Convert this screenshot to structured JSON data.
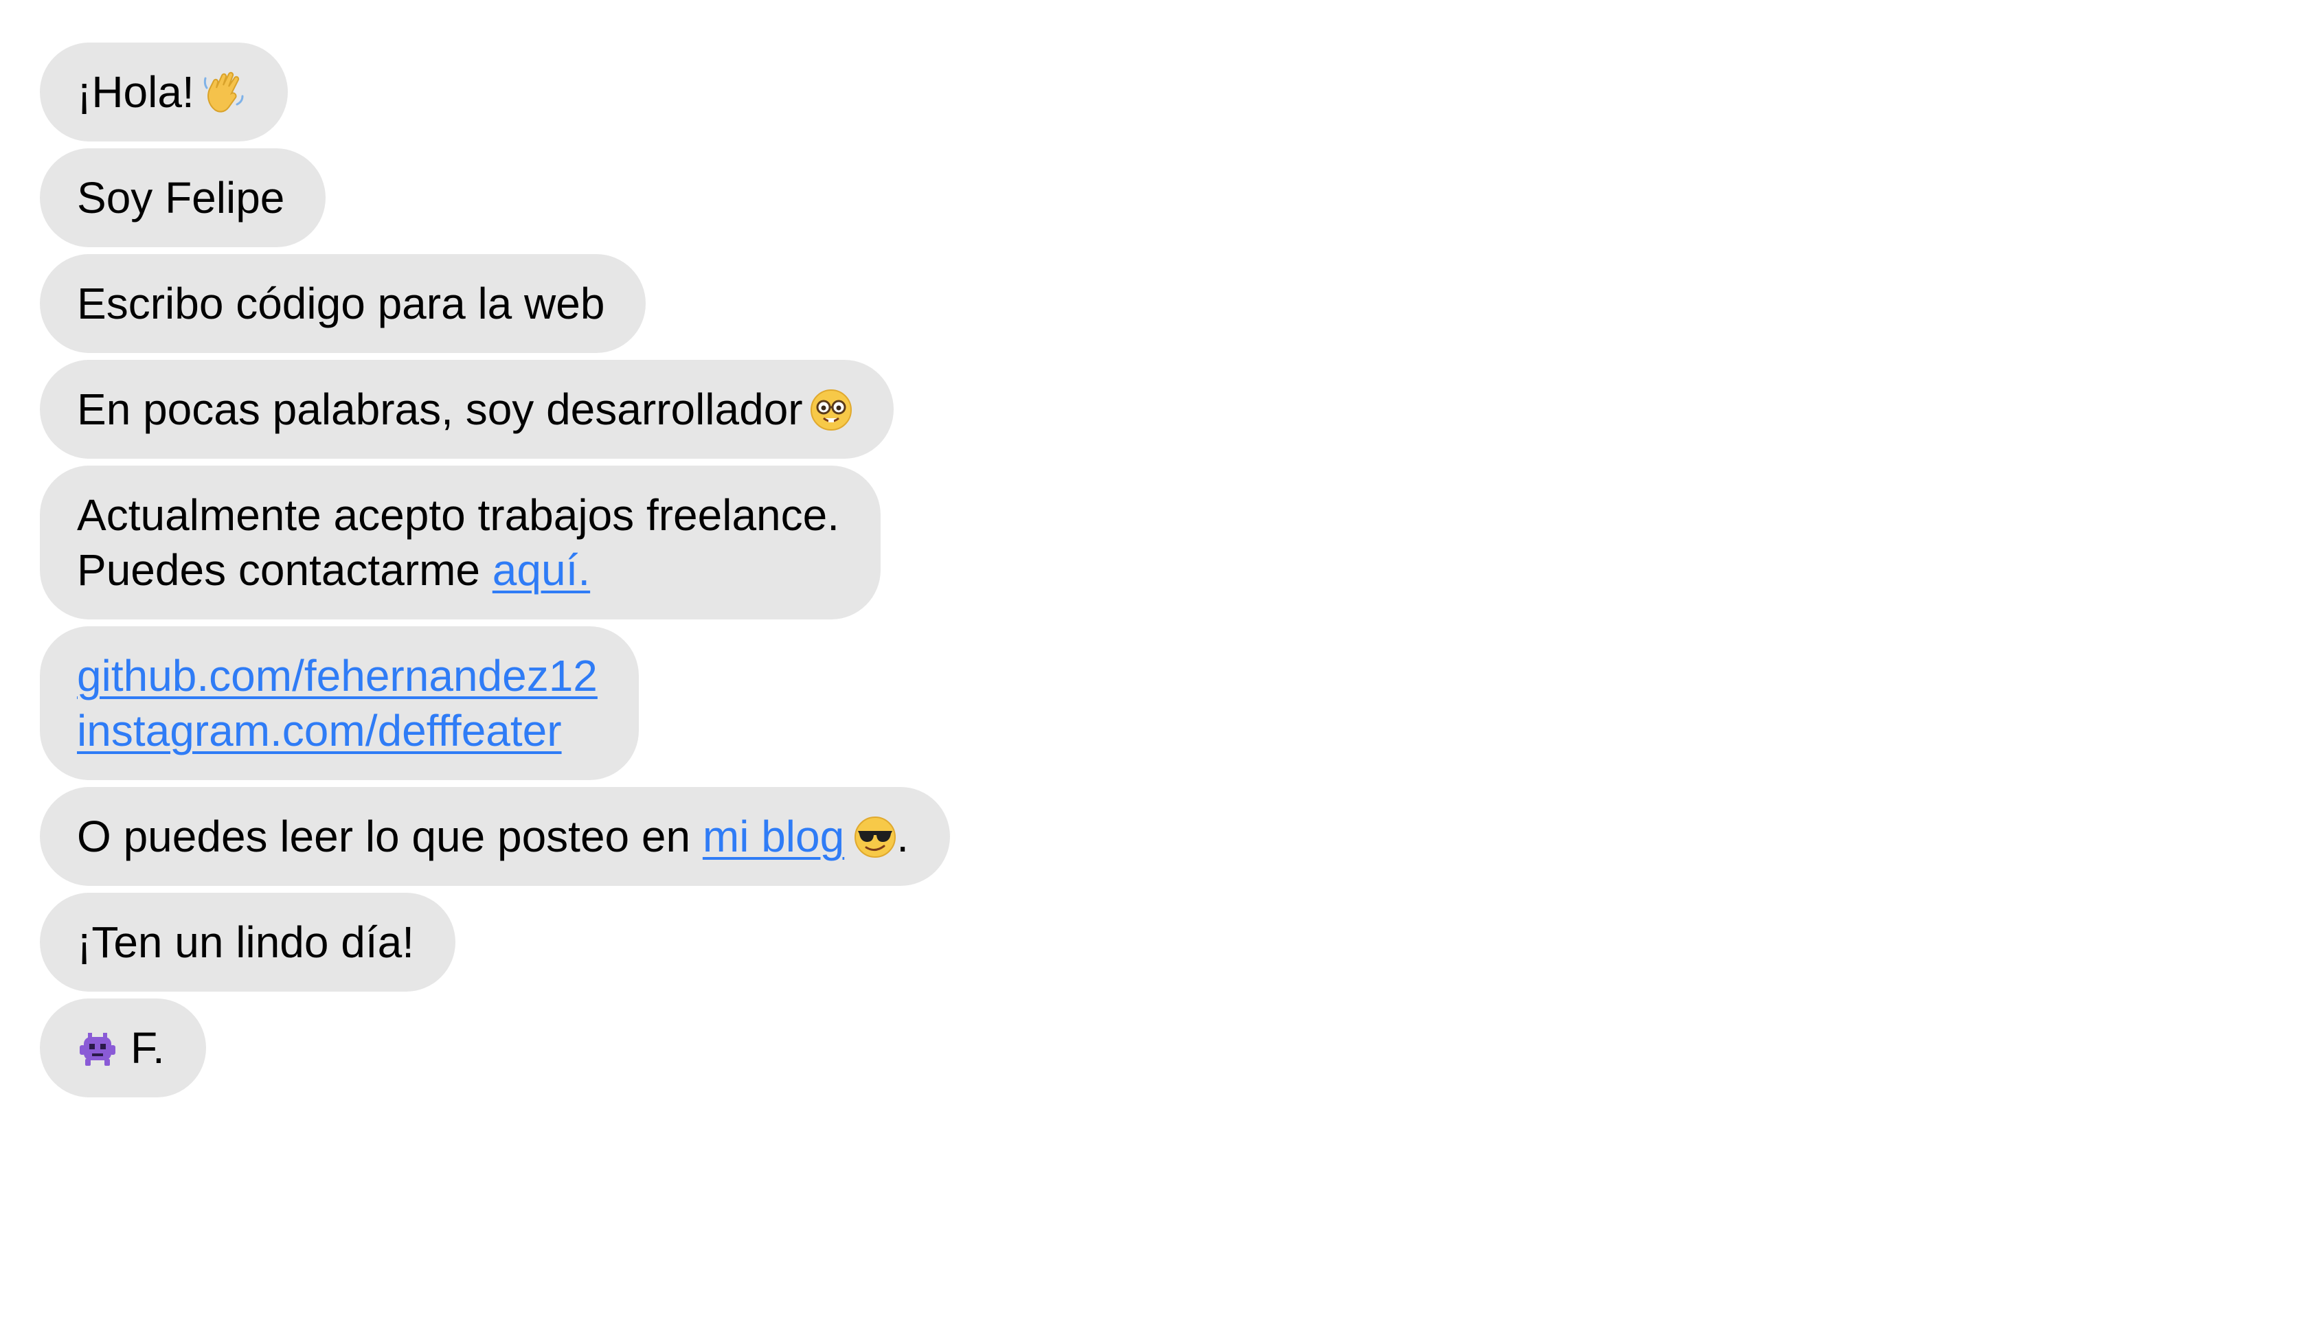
{
  "messages": {
    "greeting": "¡Hola!",
    "name": "Soy Felipe",
    "writes_code": "Escribo código para la web",
    "developer": "En pocas palabras, soy desarrollador",
    "freelance_line1": "Actualmente acepto trabajos freelance.",
    "freelance_line2": "Puedes contactarme",
    "contact_link": "aquí.",
    "github_link": "github.com/fehernandez12",
    "instagram_link": "instagram.com/defffeater",
    "blog_prefix": "O puedes leer lo que posteo en",
    "blog_link": "mi blog",
    "blog_suffix": ".",
    "farewell": "¡Ten un lindo día!",
    "signature": "F."
  },
  "icons": {
    "wave": "waving-hand-icon",
    "nerd": "nerd-face-icon",
    "cool": "sunglasses-face-icon",
    "alien": "alien-monster-icon"
  },
  "colors": {
    "bubble": "#e6e6e6",
    "link": "#2f7cf6",
    "text": "#000000"
  }
}
